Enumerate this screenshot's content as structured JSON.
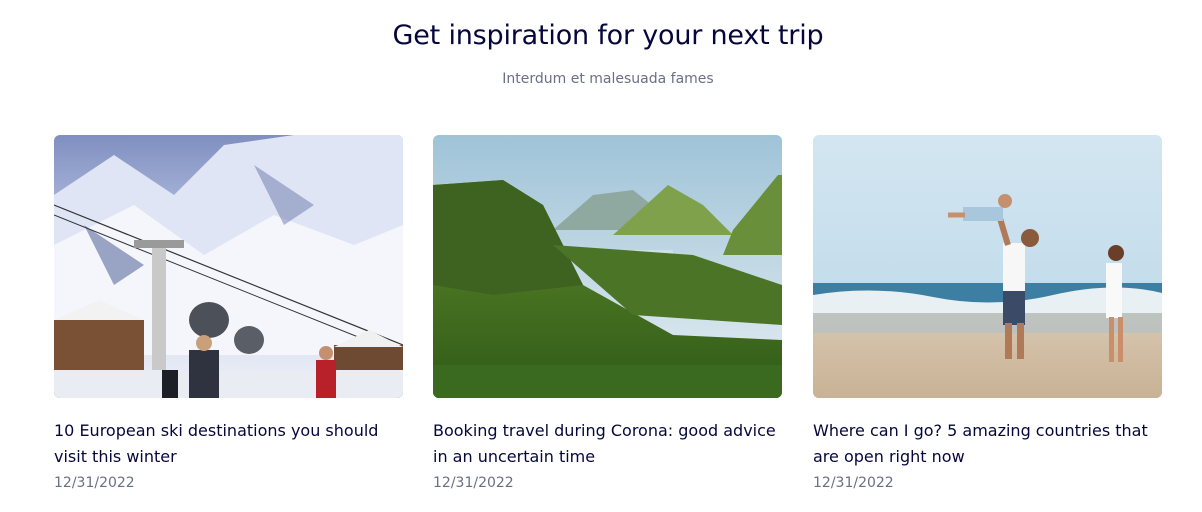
{
  "section": {
    "title": "Get inspiration for your next trip",
    "subtitle": "Interdum et malesuada fames"
  },
  "articles": [
    {
      "title": "10 European ski destinations you should visit this winter",
      "date": "12/31/2022",
      "image": "ski-resort-photo"
    },
    {
      "title": "Booking travel during Corona: good advice in an uncertain time",
      "date": "12/31/2022",
      "image": "green-mountains-photo"
    },
    {
      "title": "Where can I go? 5 amazing countries that are open right now",
      "date": "12/31/2022",
      "image": "beach-family-photo"
    }
  ]
}
